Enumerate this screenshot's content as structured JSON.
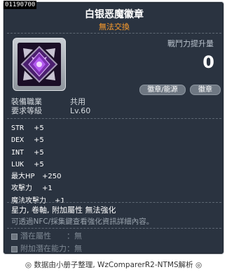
{
  "item": {
    "id": "01190700",
    "name": "白银恶魔徽章",
    "trade_status": "無法交換"
  },
  "combat_power": {
    "label": "戰鬥力提升量",
    "value": "0"
  },
  "buttons": {
    "source": "徽章/能源",
    "badge": "徽章"
  },
  "requirements": {
    "job_label": "裝備職業",
    "job_value": "共用",
    "level_label": "要求等級",
    "level_value": "Lv.60"
  },
  "stats": [
    {
      "name": "STR",
      "value": "+5"
    },
    {
      "name": "DEX",
      "value": "+5"
    },
    {
      "name": "INT",
      "value": "+5"
    },
    {
      "name": "LUK",
      "value": "+5"
    },
    {
      "name": "最大HP",
      "value": "+250"
    },
    {
      "name": "攻擊力",
      "value": "+1"
    },
    {
      "name": "魔法攻擊力",
      "value": "+1"
    }
  ],
  "description": {
    "main": "星力, 卷軸, 附加屬性 無法強化",
    "sub": "可透過NFC/採集鍵查看強化資訊詳細內容。"
  },
  "potential": {
    "potential_label": "潛在屬性",
    "potential_value": "：無",
    "bonus_label": "附加潛在能力",
    "bonus_value": "：無"
  },
  "footer": "◎ 数据由小册子整理, WzComparerR2-NTMS解析 ◎",
  "colors": {
    "panel_bg": "#2a3340",
    "trade_status": "#ff9e2c",
    "muted": "#7e8893"
  }
}
